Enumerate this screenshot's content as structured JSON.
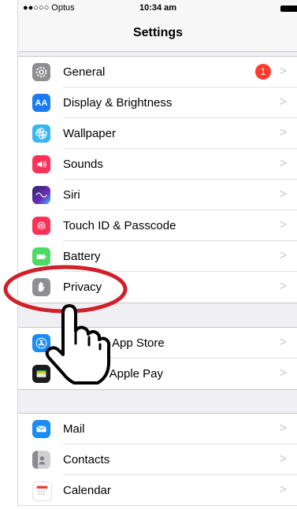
{
  "status": {
    "carrier": "●●○○○ Optus",
    "time": "10:34 am"
  },
  "nav": {
    "title": "Settings"
  },
  "groups": [
    {
      "items": [
        {
          "label": "General",
          "icon": "gear-icon",
          "color": "#8e8e93",
          "badge": "1"
        },
        {
          "label": "Display & Brightness",
          "icon": "text-size-icon",
          "color": "#1a7cf5",
          "glyph": "AA"
        },
        {
          "label": "Wallpaper",
          "icon": "flower-icon",
          "color": "#3ab5f0"
        },
        {
          "label": "Sounds",
          "icon": "speaker-icon",
          "color": "#fc3158"
        },
        {
          "label": "Siri",
          "icon": "siri-icon",
          "color": "#1b1b3a"
        },
        {
          "label": "Touch ID & Passcode",
          "icon": "fingerprint-icon",
          "color": "#fc3158"
        },
        {
          "label": "Battery",
          "icon": "battery-icon",
          "color": "#4cd964"
        },
        {
          "label": "Privacy",
          "icon": "hand-icon",
          "color": "#8e8e93"
        }
      ]
    },
    {
      "items": [
        {
          "label": "iTunes & App Store",
          "icon": "app-store-icon",
          "color": "#1a8cf5"
        },
        {
          "label": "Wallet & Apple Pay",
          "icon": "wallet-icon",
          "color": "#1c1c1e"
        }
      ]
    },
    {
      "items": [
        {
          "label": "Mail",
          "icon": "mail-icon",
          "color": "#1a8cf5"
        },
        {
          "label": "Contacts",
          "icon": "contacts-icon",
          "color": "#a3a3a8"
        },
        {
          "label": "Calendar",
          "icon": "calendar-icon",
          "color": "#ffffff"
        }
      ]
    }
  ],
  "annotation": {
    "highlight": "red-ellipse",
    "pointer": "pointing-hand-cursor",
    "color": "#d0202a"
  }
}
